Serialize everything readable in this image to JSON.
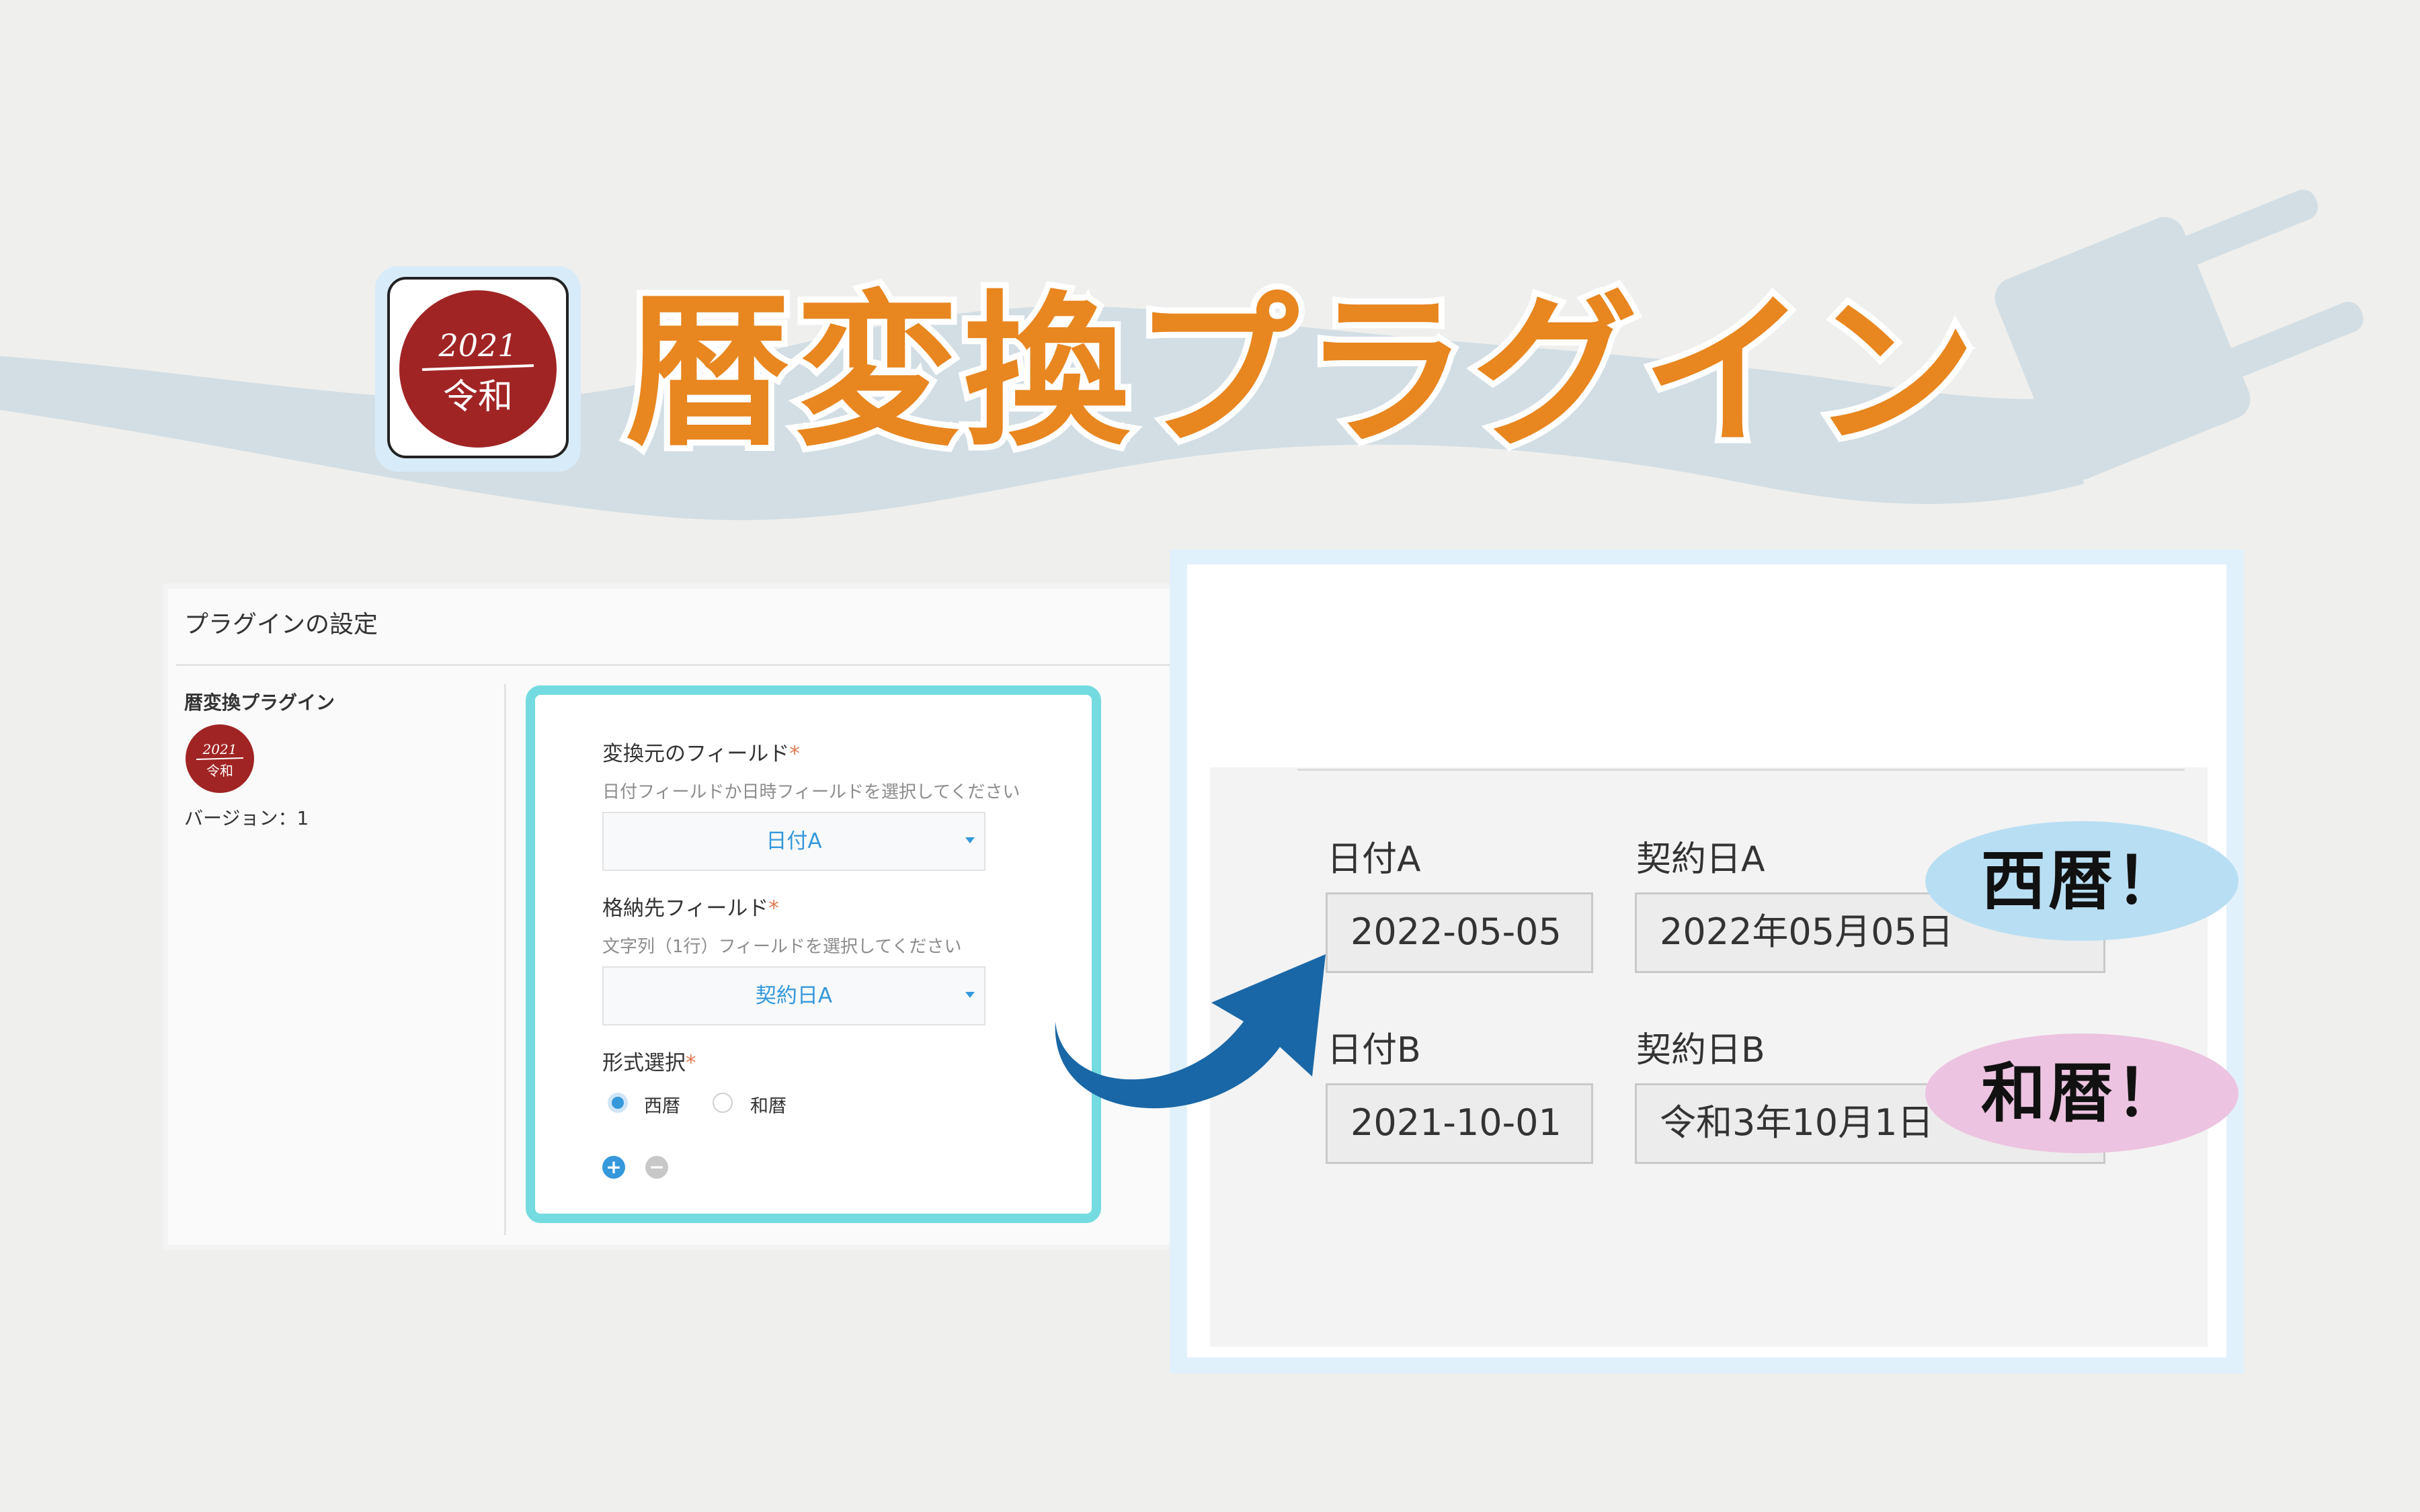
{
  "title": "暦変換プラグイン",
  "app_icon": {
    "year": "2021",
    "era": "令和",
    "seal_color": "#a12424"
  },
  "settings_screen": {
    "header": "プラグインの設定",
    "plugin_name": "暦変換プラグイン",
    "version": "バージョン：1",
    "source_field": {
      "label": "変換元のフィールド",
      "required_mark": "*",
      "hint": "日付フィールドか日時フィールドを選択してください",
      "selected": "日付A"
    },
    "target_field": {
      "label": "格納先フィールド",
      "required_mark": "*",
      "hint": "文字列（1行）フィールドを選択してください",
      "selected": "契約日A"
    },
    "format": {
      "label": "形式選択",
      "required_mark": "*",
      "options": [
        {
          "label": "西暦",
          "checked": true
        },
        {
          "label": "和暦",
          "checked": false
        }
      ]
    },
    "add_button": "+",
    "remove_button": "−"
  },
  "record_screen": {
    "rows": [
      {
        "date_label": "日付A",
        "date_value": "2022-05-05",
        "contract_label": "契約日A",
        "contract_value": "2022年05月05日",
        "bubble": "西暦！"
      },
      {
        "date_label": "日付B",
        "date_value": "2021-10-01",
        "contract_label": "契約日B",
        "contract_value": "令和3年10月1日",
        "bubble": "和暦！"
      }
    ]
  },
  "colors": {
    "title": "#e8861f",
    "accent_blue": "#3498db",
    "config_border": "#74dbe0",
    "arrow": "#1967a6",
    "bubble_seireki": "#b8def3",
    "bubble_wareki": "#ecc3e0"
  }
}
